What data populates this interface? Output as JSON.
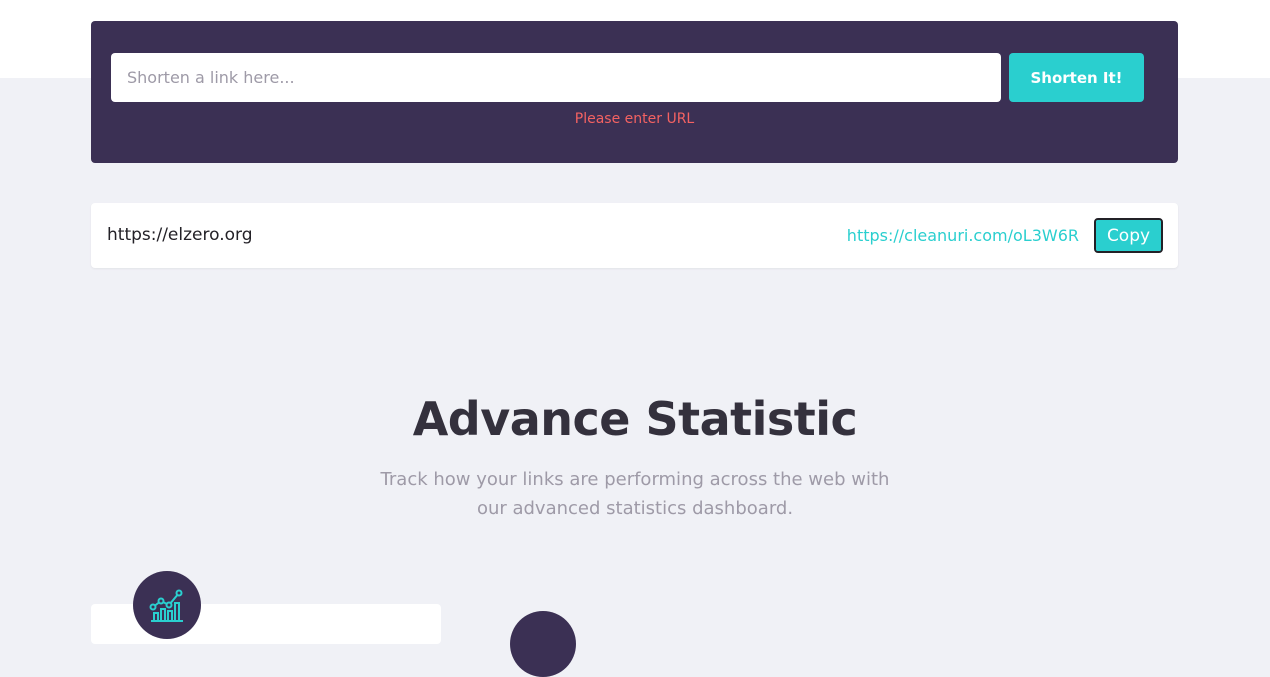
{
  "shorten": {
    "input_placeholder": "Shorten a link here...",
    "input_value": "",
    "button_label": "Shorten It!",
    "error_message": "Please enter URL"
  },
  "result": {
    "original_url": "https://elzero.org",
    "short_url": "https://cleanuri.com/oL3W6R",
    "copy_label": "Copy"
  },
  "statistics": {
    "title": "Advance Statistic",
    "subtitle_line1": "Track how your links are performing across the web with",
    "subtitle_line2": "our advanced statistics dashboard."
  },
  "features": [
    {
      "icon": "chart-icon"
    },
    {
      "icon": "feature-icon"
    }
  ],
  "colors": {
    "dark_violet": "#3b3054",
    "cyan": "#2acfcf",
    "red": "#f46262",
    "background": "#f0f1f6",
    "gray_text": "#9e9aa7"
  }
}
